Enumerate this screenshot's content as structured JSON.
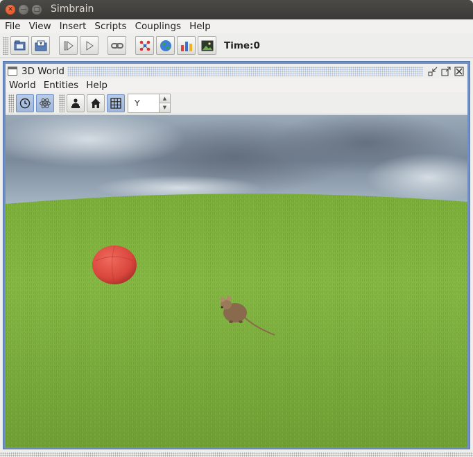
{
  "window": {
    "title": "Simbrain"
  },
  "menu": [
    "File",
    "View",
    "Insert",
    "Scripts",
    "Couplings",
    "Help"
  ],
  "toolbar": {
    "buttons": [
      "open-workspace",
      "save-workspace",
      "iterate",
      "play",
      "link",
      "network",
      "world",
      "plot",
      "image"
    ],
    "time_label": "Time:0"
  },
  "frame": {
    "title": "3D World",
    "menu": [
      "World",
      "Entities",
      "Help"
    ],
    "toolbar": {
      "buttons": [
        "clock",
        "atom",
        "agent",
        "home",
        "grid"
      ],
      "pressed": [
        "clock",
        "atom",
        "grid"
      ],
      "axis_spinner": "Y Axis"
    }
  },
  "scene": {
    "sky_color": "#8e9eaf",
    "grass_color": "#7fb33d",
    "ball_color": "#d9463c",
    "mouse_color": "#8a6a4d"
  }
}
